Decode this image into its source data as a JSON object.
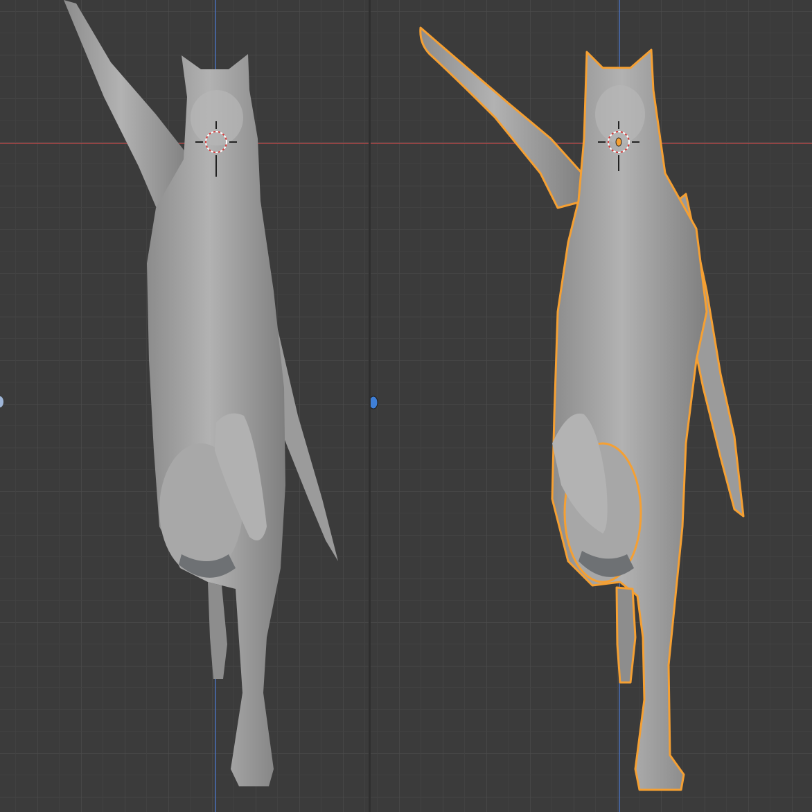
{
  "viewports": [
    {
      "id": "viewport-left",
      "object_selected": false,
      "grid": true,
      "x_axis_color": "#b04848",
      "y_axis_color": "#4a6fb8"
    },
    {
      "id": "viewport-right",
      "object_selected": true,
      "outline_color": "#f5a033",
      "grid": true,
      "x_axis_color": "#b04848",
      "y_axis_color": "#4a6fb8"
    }
  ],
  "icons": {
    "cursor": "3d-cursor-icon",
    "origin": "object-origin-icon",
    "light": "light-object-icon"
  },
  "colors": {
    "background": "#3b3b3b",
    "grid_minor": "#454545",
    "grid_major": "#4f4f4f",
    "mesh": "#a3a3a3",
    "selection_outline": "#f5a033",
    "light_dot": "#3f7fd6"
  }
}
